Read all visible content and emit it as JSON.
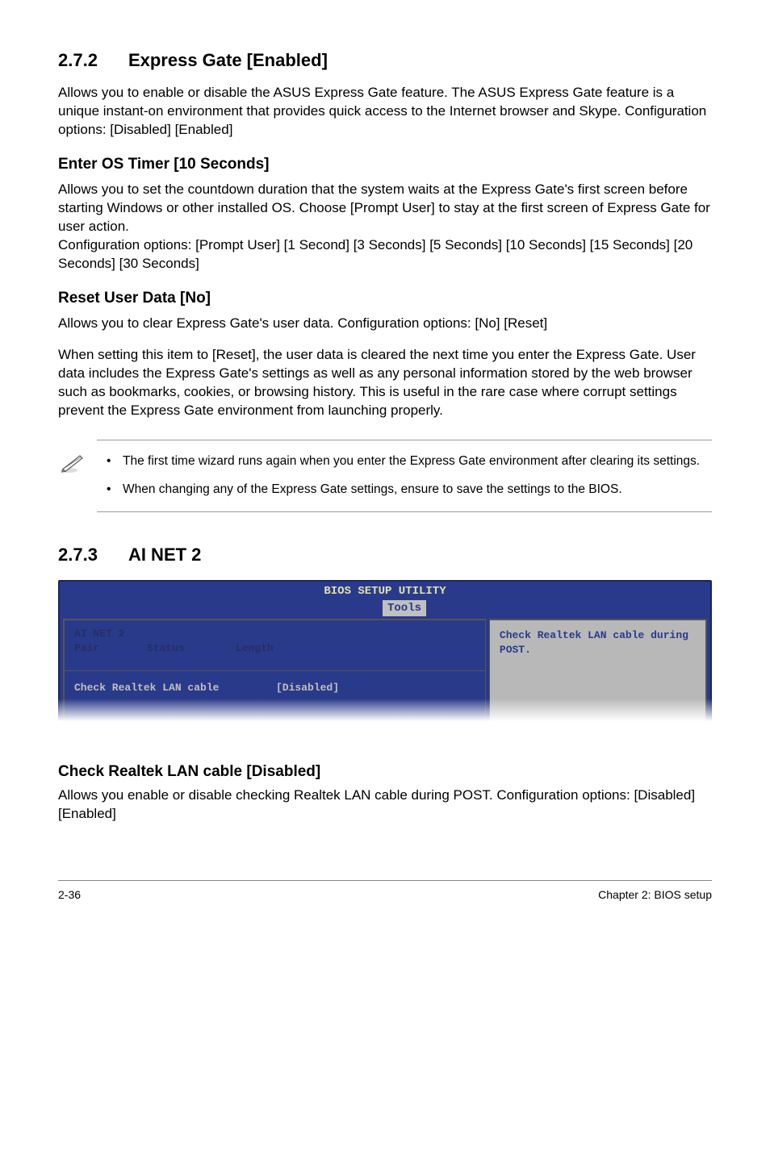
{
  "s272": {
    "num": "2.7.2",
    "title": "Express Gate [Enabled]",
    "intro": "Allows you to enable or disable the ASUS Express Gate feature. The ASUS Express Gate feature is a unique instant-on environment that provides quick access to the Internet browser and Skype. Configuration options: [Disabled] [Enabled]",
    "enter_os": {
      "heading": "Enter OS Timer [10 Seconds]",
      "text": "Allows you to set the countdown duration that the system waits at the Express Gate's first screen before starting Windows or other installed OS. Choose [Prompt User] to stay at the first screen of Express Gate for user action.\nConfiguration options: [Prompt User] [1 Second] [3 Seconds] [5 Seconds] [10 Seconds] [15 Seconds] [20 Seconds] [30 Seconds]"
    },
    "reset_user": {
      "heading": "Reset User Data [No]",
      "p1": "Allows you to clear Express Gate's user data. Configuration options: [No] [Reset]",
      "p2": "When setting this item to [Reset], the user data is cleared the next time you enter the Express Gate. User data includes the Express Gate's settings as well as any personal information stored by the web browser such as bookmarks, cookies, or browsing history. This is useful in the rare case where corrupt settings prevent the Express Gate environment from launching properly."
    },
    "notes": [
      "The first time wizard runs again when you enter the Express Gate environment after clearing its settings.",
      "When changing any of the Express Gate settings, ensure to save the settings to the BIOS."
    ]
  },
  "s273": {
    "num": "2.7.3",
    "title": "AI NET 2"
  },
  "bios": {
    "title": "BIOS SETUP UTILITY",
    "tab": "Tools",
    "col_group": "AI NET 2",
    "col1": "Pair",
    "col2": "Status",
    "col3": "Length",
    "row_label": "Check Realtek LAN cable",
    "row_value": "[Disabled]",
    "help": "Check Realtek LAN cable during POST."
  },
  "check_realtek": {
    "heading": "Check Realtek LAN cable [Disabled]",
    "text": "Allows you enable or disable checking Realtek LAN cable during POST. Configuration options: [Disabled] [Enabled]"
  },
  "footer": {
    "left": "2-36",
    "right": "Chapter 2: BIOS setup"
  }
}
